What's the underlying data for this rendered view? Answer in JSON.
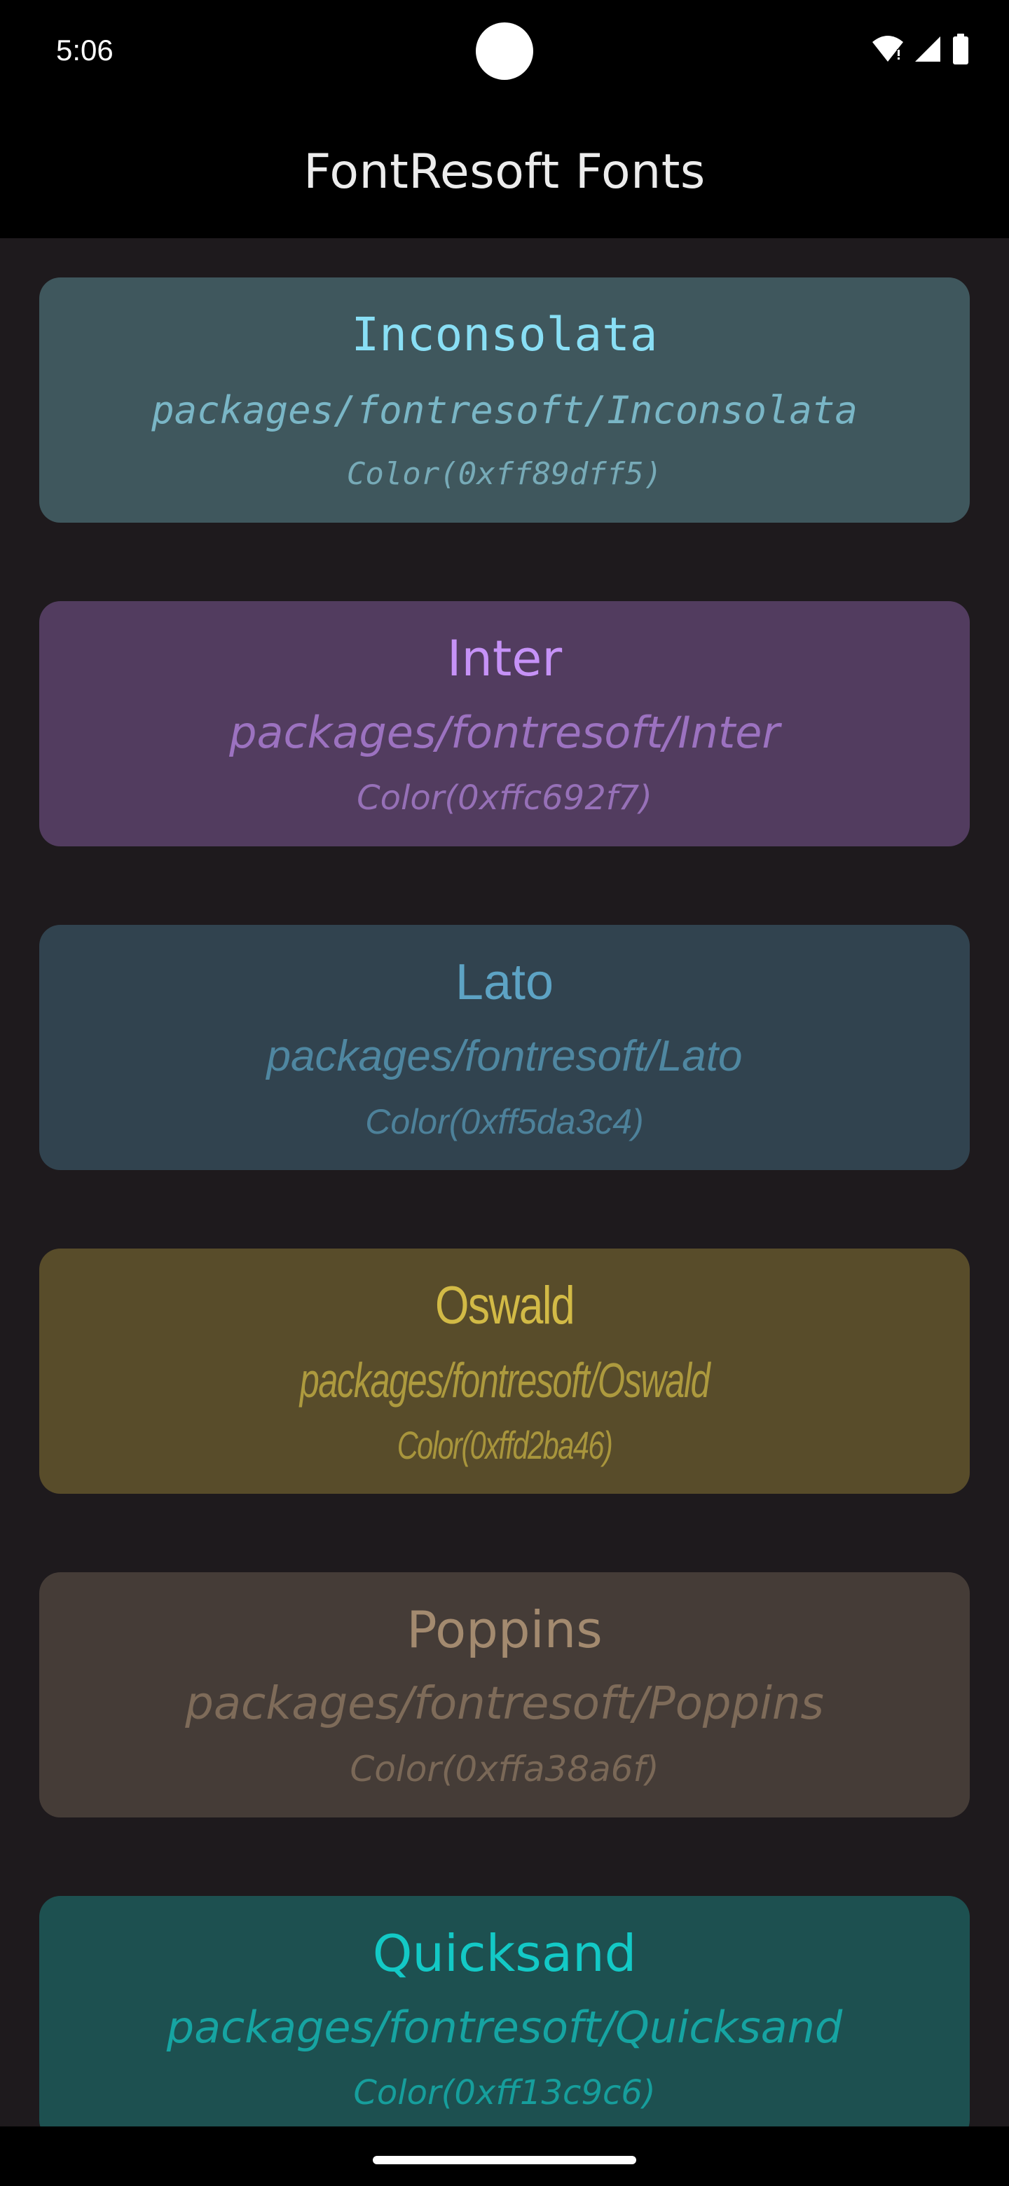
{
  "status_bar": {
    "time": "5:06",
    "icons": [
      "wifi-icon",
      "signal-icon",
      "battery-icon"
    ]
  },
  "app_bar": {
    "title": "FontResoft Fonts"
  },
  "cards": [
    {
      "name": "Inconsolata",
      "path": "packages/fontresoft/Inconsolata",
      "color": "Color(0xff89dff5)",
      "accent": "#89dff5",
      "background": "#3f575d"
    },
    {
      "name": "Inter",
      "path": "packages/fontresoft/Inter",
      "color": "Color(0xffc692f7)",
      "accent": "#c692f7",
      "background": "#523c5f"
    },
    {
      "name": "Lato",
      "path": "packages/fontresoft/Lato",
      "color": "Color(0xff5da3c4)",
      "accent": "#5da3c4",
      "background": "#31434f"
    },
    {
      "name": "Oswald",
      "path": "packages/fontresoft/Oswald",
      "color": "Color(0xffd2ba46)",
      "accent": "#d2ba46",
      "background": "#584c2a"
    },
    {
      "name": "Poppins",
      "path": "packages/fontresoft/Poppins",
      "color": "Color(0xffa38a6f)",
      "accent": "#a38a6f",
      "background": "#453c37"
    },
    {
      "name": "Quicksand",
      "path": "packages/fontresoft/Quicksand",
      "color": "Color(0xff13c9c6)",
      "accent": "#13c9c6",
      "background": "#1d5050"
    }
  ]
}
